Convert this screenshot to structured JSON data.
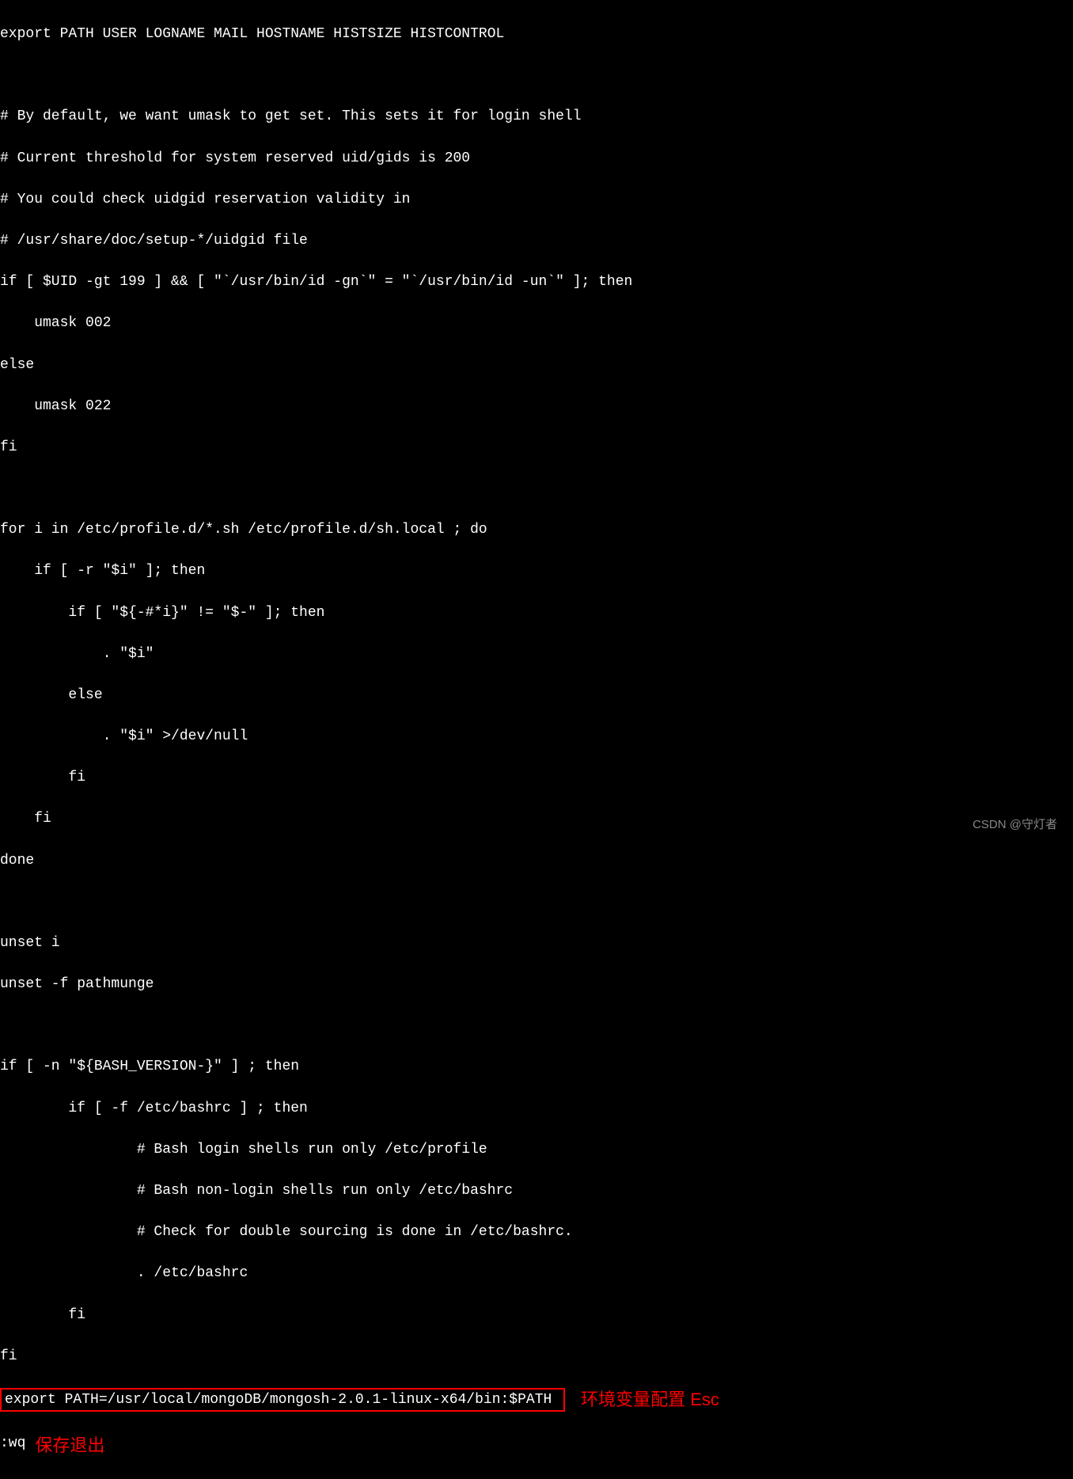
{
  "terminal": {
    "lines": [
      "export PATH USER LOGNAME MAIL HOSTNAME HISTSIZE HISTCONTROL",
      "",
      "# By default, we want umask to get set. This sets it for login shell",
      "# Current threshold for system reserved uid/gids is 200",
      "# You could check uidgid reservation validity in",
      "# /usr/share/doc/setup-*/uidgid file",
      "if [ $UID -gt 199 ] && [ \"`/usr/bin/id -gn`\" = \"`/usr/bin/id -un`\" ]; then",
      "    umask 002",
      "else",
      "    umask 022",
      "fi",
      "",
      "for i in /etc/profile.d/*.sh /etc/profile.d/sh.local ; do",
      "    if [ -r \"$i\" ]; then",
      "        if [ \"${-#*i}\" != \"$-\" ]; then",
      "            . \"$i\"",
      "        else",
      "            . \"$i\" >/dev/null",
      "        fi",
      "    fi",
      "done",
      "",
      "unset i",
      "unset -f pathmunge",
      "",
      "if [ -n \"${BASH_VERSION-}\" ] ; then",
      "        if [ -f /etc/bashrc ] ; then",
      "                # Bash login shells run only /etc/profile",
      "                # Bash non-login shells run only /etc/bashrc",
      "                # Check for double sourcing is done in /etc/bashrc.",
      "                . /etc/bashrc",
      "        fi",
      "fi"
    ],
    "highlighted_line": "export PATH=/usr/local/mongoDB/mongosh-2.0.1-linux-x64/bin:$PATH ",
    "vim_command": ":wq"
  },
  "annotations": {
    "env_config": "环境变量配置 Esc",
    "save_exit": "保存退出"
  },
  "watermark": "CSDN @守灯者"
}
